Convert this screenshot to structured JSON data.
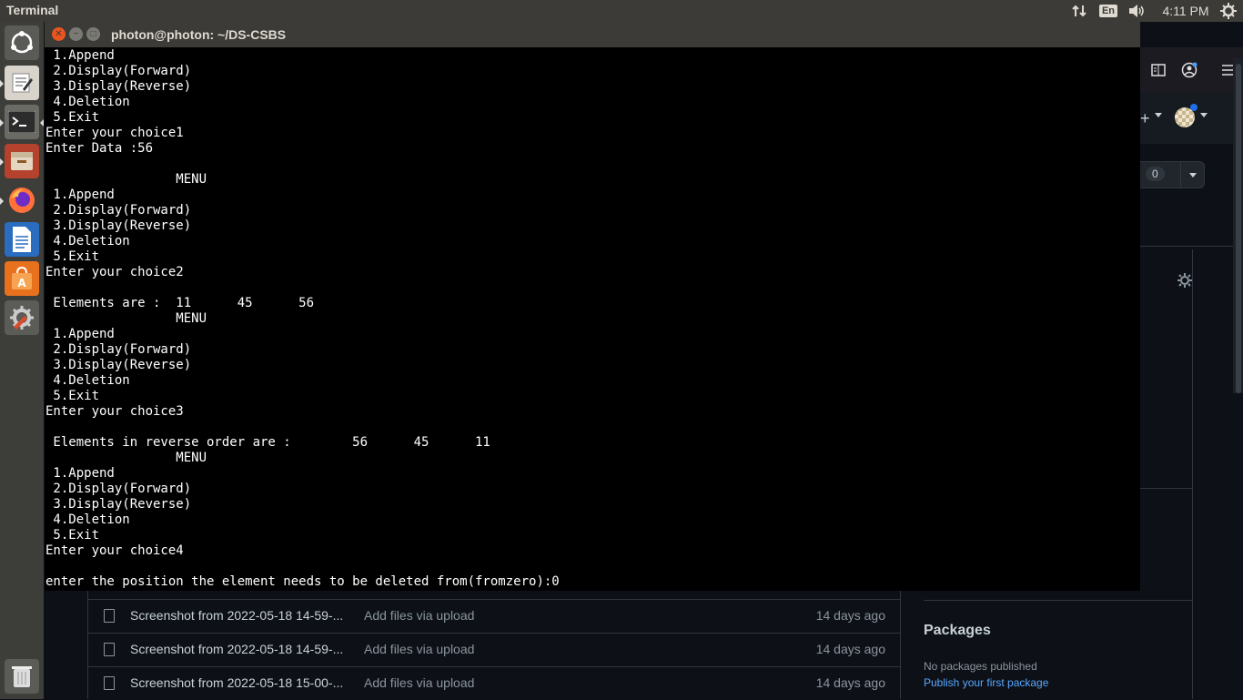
{
  "topbar": {
    "app_title": "Terminal",
    "keyboard_layout": "En",
    "clock": "4:11 PM"
  },
  "launcher": {
    "items": [
      "dash-home",
      "text-editor",
      "terminal",
      "file-manager",
      "firefox",
      "libreoffice-writer",
      "ubuntu-software",
      "system-settings",
      "trash"
    ]
  },
  "terminal": {
    "title": "photon@photon: ~/DS-CSBS",
    "lines": [
      " 1.Append",
      " 2.Display(Forward)",
      " 3.Display(Reverse)",
      " 4.Deletion",
      " 5.Exit",
      "Enter your choice1",
      "Enter Data :56",
      "",
      "                 MENU",
      " 1.Append",
      " 2.Display(Forward)",
      " 3.Display(Reverse)",
      " 4.Deletion",
      " 5.Exit",
      "Enter your choice2",
      "",
      " Elements are :  11      45      56",
      "                 MENU",
      " 1.Append",
      " 2.Display(Forward)",
      " 3.Display(Reverse)",
      " 4.Deletion",
      " 5.Exit",
      "Enter your choice3",
      "",
      " Elements in reverse order are :        56      45      11",
      "                 MENU",
      " 1.Append",
      " 2.Display(Forward)",
      " 3.Display(Reverse)",
      " 4.Deletion",
      " 5.Exit",
      "Enter your choice4",
      "",
      "enter the position the element needs to be deleted from(fromzero):0"
    ]
  },
  "github": {
    "counter": "0",
    "files": [
      {
        "name": "Screenshot from 2022-05-18 14-59-...",
        "message": "Add files via upload",
        "age": "14 days ago"
      },
      {
        "name": "Screenshot from 2022-05-18 14-59-...",
        "message": "Add files via upload",
        "age": "14 days ago"
      },
      {
        "name": "Screenshot from 2022-05-18 15-00-...",
        "message": "Add files via upload",
        "age": "14 days ago"
      }
    ],
    "packages": {
      "heading": "Packages",
      "empty_text": "No packages published",
      "publish_link": "Publish your first package"
    }
  },
  "colors": {
    "ubuntu_panel": "#3c3b37",
    "launcher_bg": "#3d3d3a",
    "terminal_bg": "#000000",
    "close_button": "#e95420",
    "github_bg": "#0d1117",
    "link": "#58a6ff"
  }
}
